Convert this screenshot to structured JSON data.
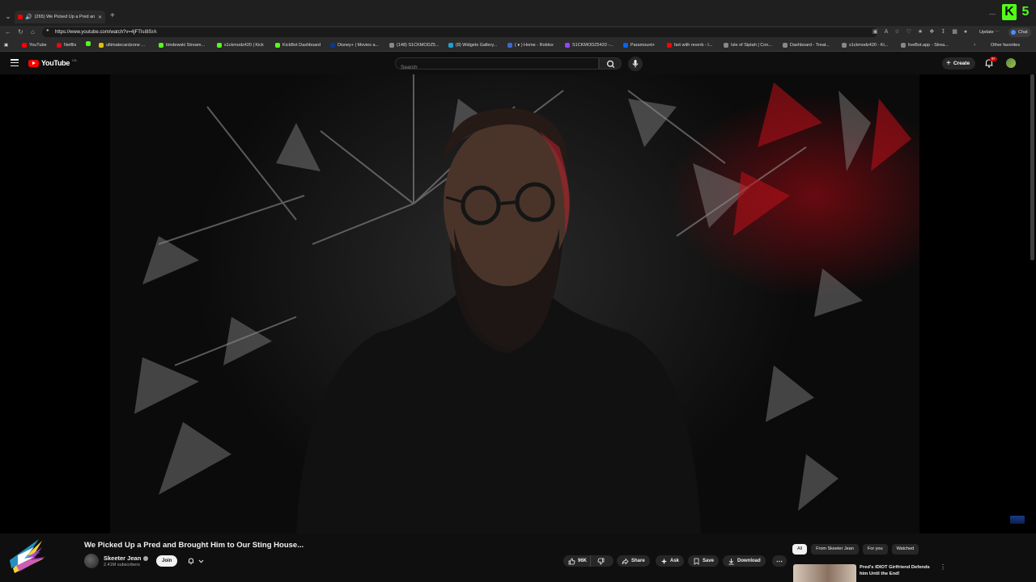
{
  "browser": {
    "tab_title": "(265) We Picked Up a Pred an",
    "url": "https://www.youtube.com/watch?v=4jFTIsI8SrA",
    "update_label": "Update",
    "chat_label": "Chat",
    "kick_letters": [
      "K",
      "5"
    ],
    "bookmarks": [
      {
        "label": "YouTube",
        "icon": "youtube-icon",
        "color": "#ff0000"
      },
      {
        "label": "Netflix",
        "icon": "netflix-icon",
        "color": "#e50914"
      },
      {
        "label": "ultimatecardzone ...",
        "icon": "globe-icon",
        "color": "#e0c000"
      },
      {
        "label": "timdewski Stream...",
        "icon": "kick-icon",
        "color": "#53fc18"
      },
      {
        "label": "s1ckmodz420 | Kick",
        "icon": "kick-icon",
        "color": "#53fc18"
      },
      {
        "label": "KickBot Dashboard",
        "icon": "kick-icon",
        "color": "#53fc18"
      },
      {
        "label": "Disney+ | Movies a...",
        "icon": "disney-icon",
        "color": "#0b3a8a"
      },
      {
        "label": "(148) S1CKMODZ5...",
        "icon": "globe-icon",
        "color": "#888888"
      },
      {
        "label": "(8) Widgets Gallery...",
        "icon": "widgets-icon",
        "color": "#20a0d0"
      },
      {
        "label": "( ♦ ) Home - Roblox",
        "icon": "roblox-icon",
        "color": "#3a6ad0"
      },
      {
        "label": "S1CKMODZ5420 -...",
        "icon": "twitch-icon",
        "color": "#9146ff"
      },
      {
        "label": "Paramount+",
        "icon": "paramount-icon",
        "color": "#0064ff"
      },
      {
        "label": "fart with reverb - I...",
        "icon": "youtube-icon",
        "color": "#ff0000"
      },
      {
        "label": "Isle of Siptah | Con...",
        "icon": "globe-icon",
        "color": "#888888"
      },
      {
        "label": "Dashboard - Treat...",
        "icon": "globe-icon",
        "color": "#888888"
      },
      {
        "label": "s1ckmodz420 - Ki...",
        "icon": "globe-icon",
        "color": "#888888"
      },
      {
        "label": "liveBot.app - Strea...",
        "icon": "globe-icon",
        "color": "#888888"
      }
    ],
    "other_favorites": "Other favorites"
  },
  "youtube": {
    "logo_text": "YouTube",
    "country_code": "CA",
    "search_placeholder": "Search",
    "create_label": "Create",
    "notification_badge": "9+"
  },
  "video": {
    "title": "We Picked Up a Pred and Brought Him to Our Sting House...",
    "channel_name": "Skeeter Jean",
    "subscribers": "2.41M subscribers",
    "join_label": "Join",
    "likes": "96K",
    "share_label": "Share",
    "ask_label": "Ask",
    "save_label": "Save",
    "download_label": "Download"
  },
  "recommendations": {
    "chips": [
      "All",
      "From Skeeter Jean",
      "For you",
      "Watched"
    ],
    "active_chip": "All",
    "first_video_title": "Pred's IDIOT Girlfriend Defends him Until the End!"
  },
  "colors": {
    "brand_red": "#ff0000",
    "kick_green": "#53fc18",
    "background": "#0f0f0f"
  }
}
